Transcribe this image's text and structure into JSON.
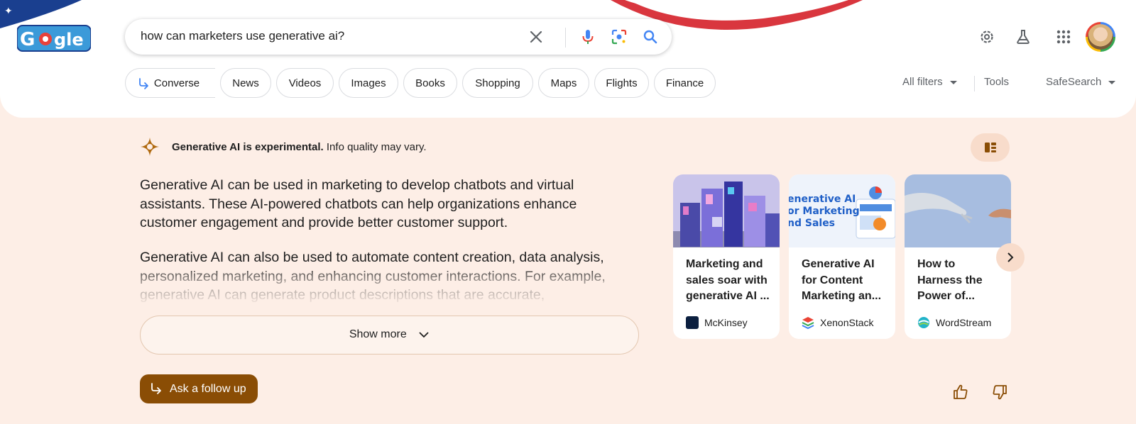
{
  "search": {
    "query": "how can marketers use generative ai?"
  },
  "tabs": [
    {
      "label": "Converse",
      "has_icon": true
    },
    {
      "label": "News"
    },
    {
      "label": "Videos"
    },
    {
      "label": "Images"
    },
    {
      "label": "Books"
    },
    {
      "label": "Shopping"
    },
    {
      "label": "Maps"
    },
    {
      "label": "Flights"
    },
    {
      "label": "Finance"
    }
  ],
  "filters": {
    "all_filters": "All filters",
    "tools": "Tools",
    "safesearch": "SafeSearch"
  },
  "ai": {
    "notice_bold": "Generative AI is experimental.",
    "notice_rest": " Info quality may vary.",
    "para1": "Generative AI can be used in marketing to develop chatbots and virtual assistants. These AI-powered chatbots can help organizations enhance customer engagement and provide better customer support.",
    "para2": "Generative AI can also be used to automate content creation, data analysis, personalized marketing, and enhancing customer interactions. For example, generative AI can generate product descriptions that are accurate,",
    "show_more": "Show more",
    "follow_up": "Ask a follow up"
  },
  "cards": [
    {
      "title": "Marketing and sales soar with generative AI ...",
      "source": "McKinsey"
    },
    {
      "title": "Generative AI for Content Marketing an...",
      "source": "XenonStack",
      "thumb_text": "Generative AI or Marketing and Sales"
    },
    {
      "title": "How to Harness the Power of...",
      "source": "WordStream"
    }
  ],
  "colors": {
    "page_bg": "#fdeee6",
    "accent_brown": "#8a4d05",
    "google_blue": "#4285f4",
    "google_red": "#ea4335",
    "google_yellow": "#fbbc05",
    "google_green": "#34a853"
  },
  "icons": [
    "flag-doodle",
    "clear-icon",
    "microphone-icon",
    "lens-icon",
    "search-icon",
    "settings-icon",
    "labs-icon",
    "apps-icon",
    "avatar",
    "converse-arrow-icon",
    "sparkle-icon",
    "layout-icon",
    "chevron-down-icon",
    "reply-arrow-icon",
    "chevron-right-icon",
    "thumbs-up-icon",
    "thumbs-down-icon"
  ]
}
